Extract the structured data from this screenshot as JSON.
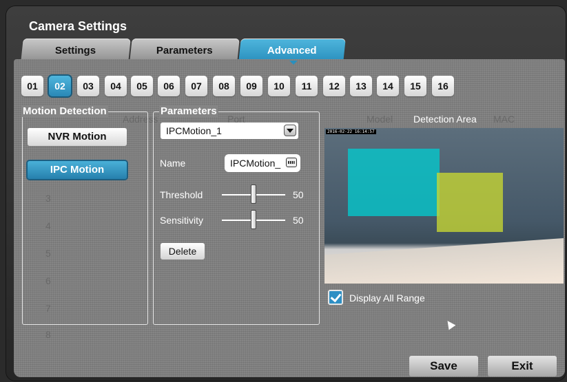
{
  "window": {
    "title": "Camera Settings"
  },
  "tabs": [
    {
      "label": "Settings",
      "active": false
    },
    {
      "label": "Parameters",
      "active": false
    },
    {
      "label": "Advanced",
      "active": true
    }
  ],
  "channels": {
    "items": [
      "01",
      "02",
      "03",
      "04",
      "05",
      "06",
      "07",
      "08",
      "09",
      "10",
      "11",
      "12",
      "13",
      "14",
      "15",
      "16"
    ],
    "selected": "02"
  },
  "background_ghost": {
    "header_items": [
      "Address",
      "Port",
      "Model",
      "MAC"
    ],
    "row_numbers": [
      "3",
      "4",
      "5",
      "6",
      "7",
      "8"
    ]
  },
  "motion_detection": {
    "legend": "Motion Detection",
    "nvr_label": "NVR Motion",
    "ipc_label": "IPC Motion",
    "selected": "IPC Motion"
  },
  "parameters": {
    "legend": "Parameters",
    "selected_motion": "IPCMotion_1",
    "name_label": "Name",
    "name_value": "IPCMotion_",
    "threshold_label": "Threshold",
    "threshold_value": "50",
    "sensitivity_label": "Sensitivity",
    "sensitivity_value": "50",
    "delete_label": "Delete"
  },
  "detection_area": {
    "title": "Detection Area",
    "timestamp": "2016-02-22 16:14:57",
    "display_all_label": "Display All Range",
    "display_all_checked": true
  },
  "actions": {
    "save_label": "Save",
    "exit_label": "Exit"
  },
  "colors": {
    "accent": "#2a8fbd",
    "panel": "#858585",
    "zone_cyan": "#00cdd2",
    "zone_yellow": "#c8d732"
  },
  "icons": {
    "dropdown": "chevron-down-icon",
    "keyboard": "keyboard-icon",
    "checkbox": "checkmark-icon",
    "pointer": "mouse-cursor-icon"
  }
}
